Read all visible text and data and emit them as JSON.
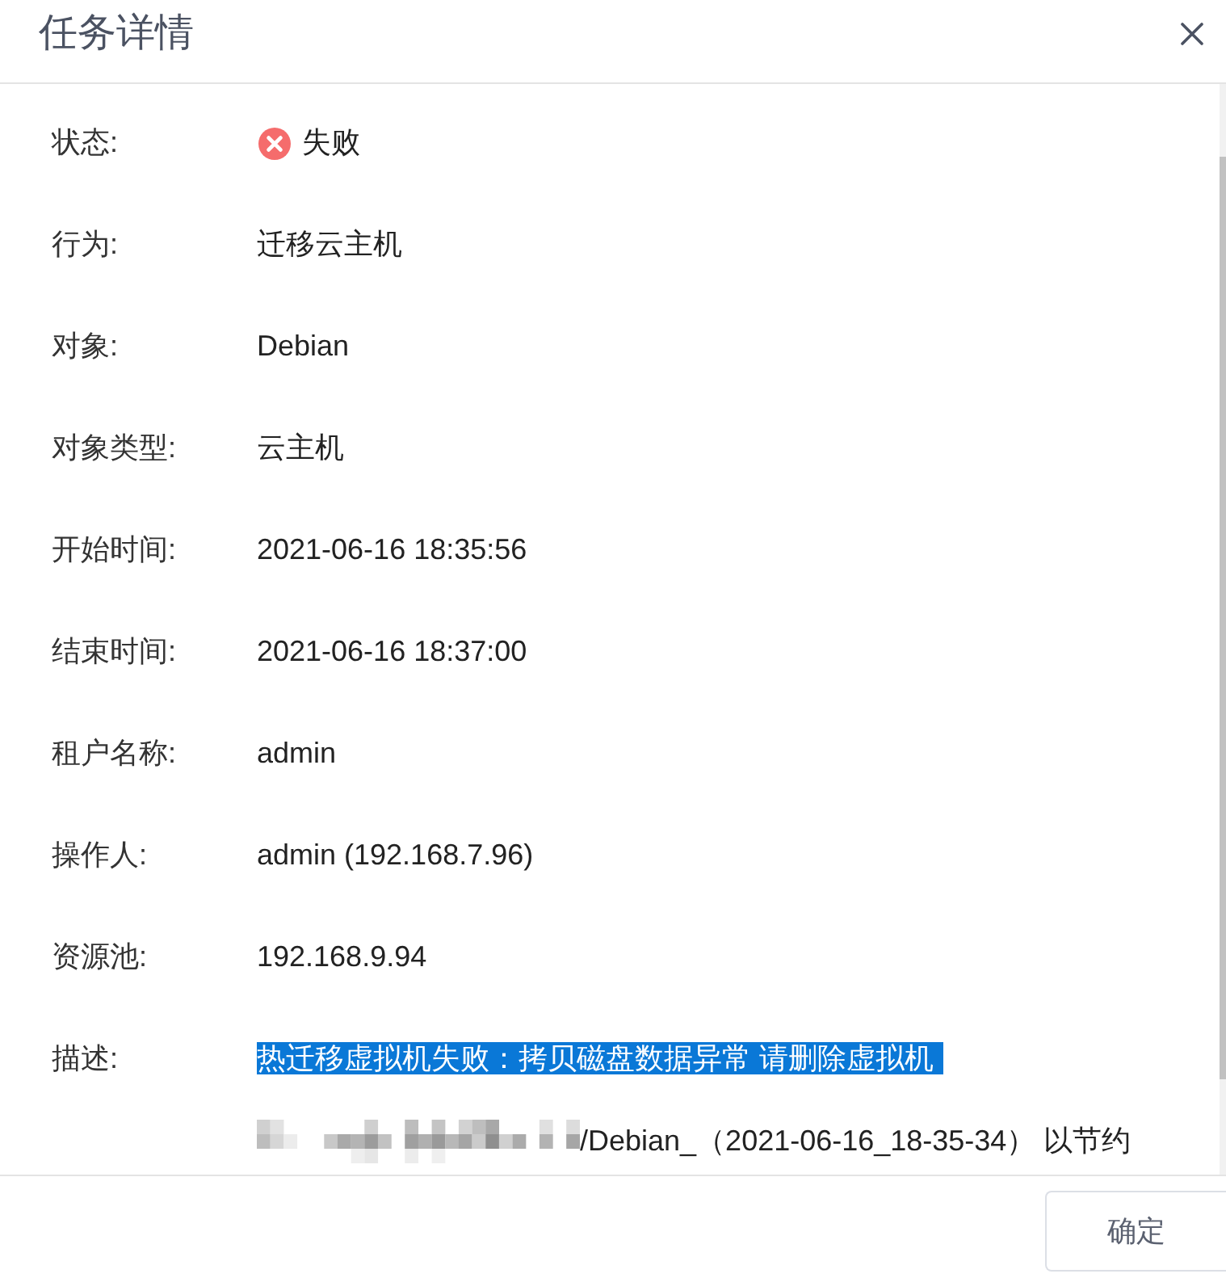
{
  "dialog": {
    "title": "任务详情"
  },
  "fields": [
    {
      "kind": "status",
      "label": "状态:",
      "value": "失败",
      "failed": true
    },
    {
      "kind": "text",
      "label": "行为:",
      "value": "迁移云主机"
    },
    {
      "kind": "text",
      "label": "对象:",
      "value": "Debian"
    },
    {
      "kind": "text",
      "label": "对象类型:",
      "value": "云主机"
    },
    {
      "kind": "text",
      "label": "开始时间:",
      "value": "2021-06-16 18:35:56"
    },
    {
      "kind": "text",
      "label": "结束时间:",
      "value": "2021-06-16 18:37:00"
    },
    {
      "kind": "text",
      "label": "租户名称:",
      "value": "admin"
    },
    {
      "kind": "text",
      "label": "操作人:",
      "value": "admin (192.168.7.96)"
    },
    {
      "kind": "text",
      "label": "资源池:",
      "value": "192.168.9.94"
    },
    {
      "kind": "description",
      "label": "描述:",
      "highlighted": "热迁移虚拟机失败：拷贝磁盘数据异常 请删除虚拟机",
      "selected": true,
      "continuation": "/Debian_（2021-06-16_18-35-34） 以节约"
    }
  ],
  "footer": {
    "buttons": [
      {
        "label": "确定"
      }
    ]
  }
}
